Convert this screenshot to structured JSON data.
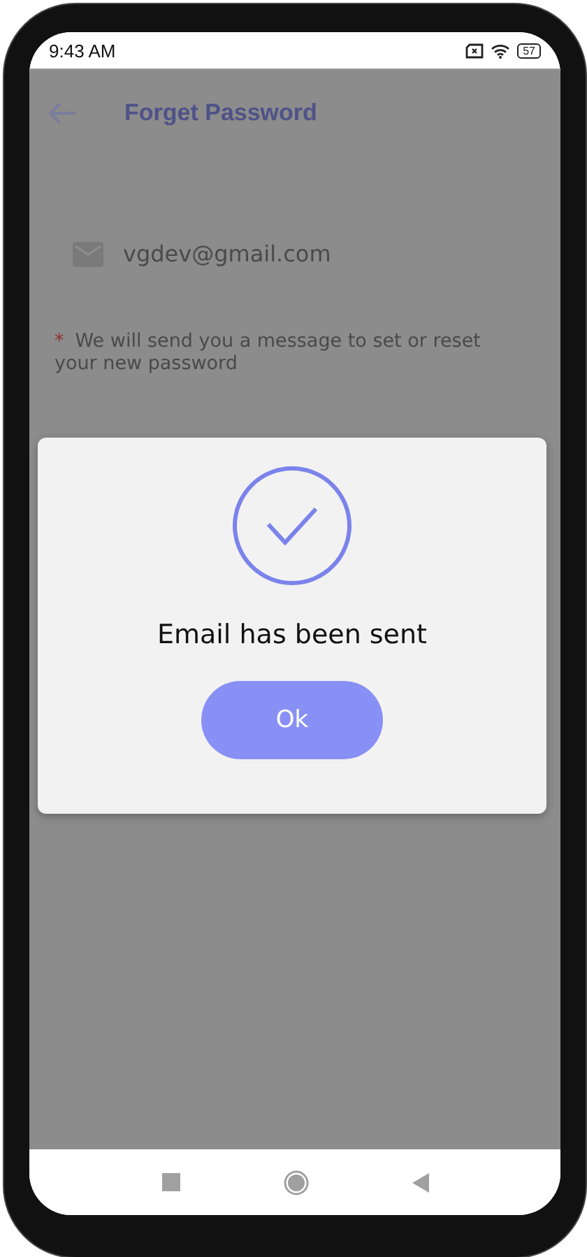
{
  "status_bar": {
    "time": "9:43 AM",
    "battery": "57"
  },
  "app_bar": {
    "title": "Forget Password"
  },
  "email_field": {
    "value": "vgdev@gmail.com"
  },
  "note": {
    "mark": "*",
    "text": "We will send you a message to set or reset your new password"
  },
  "dialog": {
    "message": "Email has been sent",
    "button": "Ok"
  }
}
